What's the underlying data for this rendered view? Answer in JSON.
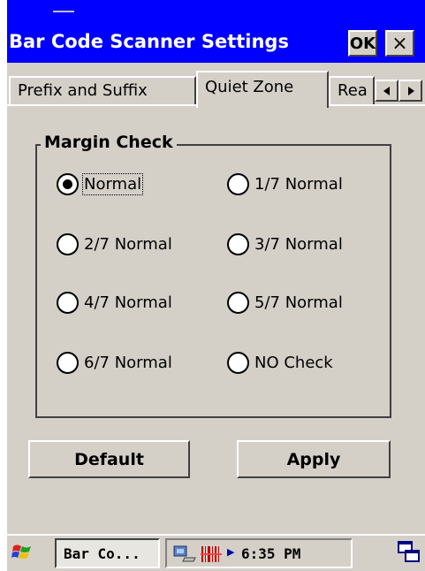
{
  "window": {
    "title": "Bar Code Scanner Settings",
    "ok_label": "OK",
    "close_label": "×"
  },
  "tabs": [
    {
      "label": "Prefix and Suffix",
      "active": false
    },
    {
      "label": "Quiet Zone",
      "active": true
    },
    {
      "label": "Rea",
      "active": false
    }
  ],
  "tab_scroll": {
    "left_icon": "triangle-left",
    "right_icon": "triangle-right"
  },
  "margin_check": {
    "label": "Margin Check",
    "options": [
      {
        "label": "Normal",
        "selected": true
      },
      {
        "label": "1/7 Normal",
        "selected": false
      },
      {
        "label": "2/7 Normal",
        "selected": false
      },
      {
        "label": "3/7 Normal",
        "selected": false
      },
      {
        "label": "4/7 Normal",
        "selected": false
      },
      {
        "label": "5/7 Normal",
        "selected": false
      },
      {
        "label": "6/7 Normal",
        "selected": false
      },
      {
        "label": "NO Check",
        "selected": false
      }
    ]
  },
  "buttons": {
    "default": "Default",
    "apply": "Apply"
  },
  "taskbar": {
    "task_label": "Bar Co...",
    "clock": "6:35 PM",
    "start_icon": "windows-flag-icon",
    "tray_icons": [
      "network-icon",
      "barcode-icon",
      "arrow-icon"
    ],
    "desktop_icon": "desktop-windows-icon"
  },
  "colors": {
    "titlebar": "#0000ff",
    "face": "#d4d0c8"
  }
}
